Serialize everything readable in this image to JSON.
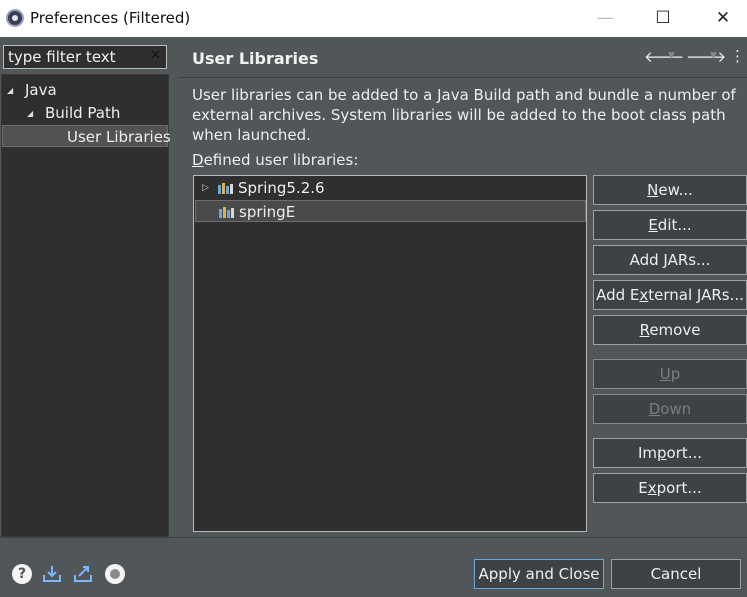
{
  "window": {
    "title": "Preferences (Filtered)",
    "minimize_glyph": "—",
    "maximize_glyph": "☐",
    "close_glyph": "✕"
  },
  "filter": {
    "placeholder": "type filter text",
    "value": "type filter text"
  },
  "tree": {
    "items": [
      {
        "label": "Java",
        "expanded": true
      },
      {
        "label": "Build Path",
        "expanded": true
      },
      {
        "label": "User Libraries",
        "selected": true
      }
    ]
  },
  "page": {
    "title": "User Libraries",
    "description": "User libraries can be added to a Java Build path and bundle a number of external archives. System libraries will be added to the boot class path when launched.",
    "defined_label_mnemonic": "D",
    "defined_label_rest": "efined user libraries:"
  },
  "libraries": [
    {
      "name": "Spring5.2.6",
      "expandable": true
    },
    {
      "name": "springE",
      "expandable": false,
      "selected": true
    }
  ],
  "buttons": [
    {
      "pre": "",
      "mn": "N",
      "post": "ew...",
      "enabled": true
    },
    {
      "pre": "",
      "mn": "E",
      "post": "dit...",
      "enabled": true
    },
    {
      "pre": "Add ",
      "mn": "J",
      "post": "ARs...",
      "enabled": true
    },
    {
      "pre": "Add E",
      "mn": "x",
      "post": "ternal JARs...",
      "enabled": true
    },
    {
      "pre": "",
      "mn": "R",
      "post": "emove",
      "enabled": true
    },
    {
      "pre": "",
      "mn": "U",
      "post": "p",
      "enabled": false
    },
    {
      "pre": "",
      "mn": "D",
      "post": "own",
      "enabled": false
    },
    {
      "pre": "Im",
      "mn": "p",
      "post": "ort...",
      "enabled": true
    },
    {
      "pre": "E",
      "mn": "x",
      "post": "port...",
      "enabled": true
    }
  ],
  "footer": {
    "apply_close_label": "Apply and Close",
    "cancel_label": "Cancel"
  },
  "icons": {
    "help": "question-icon",
    "import": "import-icon",
    "export": "export-icon",
    "record": "record-icon"
  },
  "colors": {
    "background": "#515658",
    "panel": "#2f2f2f",
    "accent_border": "#6aa6d8"
  }
}
